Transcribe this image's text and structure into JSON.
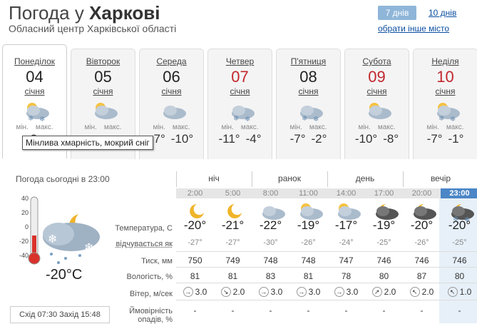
{
  "header": {
    "title_prefix": "Погода",
    "title_mid": "у",
    "title_city": "Харкові",
    "subtitle": "Обласний центр Харківської області",
    "period_7": "7 днів",
    "period_10": "10 днів",
    "other_place": "обрати інше місто"
  },
  "days": [
    {
      "day": "Понеділок",
      "date": "04",
      "month": "січня",
      "icon": "cloud-sun-snow-rain-icon",
      "min_label": "мін.",
      "max_label": "макс.",
      "min": "-2",
      "max": "",
      "red": false
    },
    {
      "day": "Вівторок",
      "date": "05",
      "month": "січня",
      "icon": "sun-cloud-icon",
      "min_label": "мін.",
      "max_label": "макс.",
      "min": "",
      "max": "",
      "red": false
    },
    {
      "day": "Середа",
      "date": "06",
      "month": "січня",
      "icon": "cloudy-icon",
      "min_label": "мін.",
      "max_label": "макс.",
      "min": "-7°",
      "max": "-10°",
      "red": false
    },
    {
      "day": "Четвер",
      "date": "07",
      "month": "січня",
      "icon": "snow-cloud-icon",
      "min_label": "мін.",
      "max_label": "макс.",
      "min": "-11°",
      "max": "-4°",
      "red": true
    },
    {
      "day": "П'ятниця",
      "date": "08",
      "month": "січня",
      "icon": "snow-cloud-icon",
      "min_label": "мін.",
      "max_label": "макс.",
      "min": "-7°",
      "max": "-2°",
      "red": false
    },
    {
      "day": "Субота",
      "date": "09",
      "month": "січня",
      "icon": "sun-cloud-icon",
      "min_label": "мін.",
      "max_label": "макс.",
      "min": "-10°",
      "max": "-8°",
      "red": true
    },
    {
      "day": "Неділя",
      "date": "10",
      "month": "січня",
      "icon": "cloud-sun-snow-icon",
      "min_label": "мін.",
      "max_label": "макс.",
      "min": "-7°",
      "max": "-1°",
      "red": true
    }
  ],
  "tooltip": "Мінлива хмарність, мокрий сніг",
  "now": {
    "label": "Погода сьогодні в 23:00",
    "temp": "-20°C",
    "scale": [
      "40",
      "20",
      "0",
      "-20",
      "-40"
    ],
    "sunrise": "Схід 07:30 Захід 15:48",
    "icon": "moon-cloud-snow-icon"
  },
  "row_labels": {
    "temp": "Температура, С",
    "feel": "відчувається як",
    "press": "Тиск, мм",
    "hum": "Вологість, %",
    "wind": "Вітер, м/сек",
    "prec1": "Ймовірність",
    "prec2": "опадів, %"
  },
  "sections": [
    "ніч",
    "ранок",
    "день",
    "вечір"
  ],
  "hours": [
    {
      "time": "2:00",
      "icon": "moon-icon",
      "temp": "-20°",
      "feel": "-27°",
      "press": "750",
      "hum": "81",
      "wdir": "→",
      "wind": "3.0",
      "prec": "-"
    },
    {
      "time": "5:00",
      "icon": "moon-icon",
      "temp": "-21°",
      "feel": "-27°",
      "press": "749",
      "hum": "81",
      "wdir": "↘",
      "wind": "2.0",
      "prec": "-"
    },
    {
      "time": "8:00",
      "icon": "cloudy-icon",
      "temp": "-22°",
      "feel": "-30°",
      "press": "748",
      "hum": "83",
      "wdir": "→",
      "wind": "3.0",
      "prec": "-"
    },
    {
      "time": "11:00",
      "icon": "sun-cloud-icon",
      "temp": "-19°",
      "feel": "-26°",
      "press": "748",
      "hum": "81",
      "wdir": "→",
      "wind": "3.0",
      "prec": "-"
    },
    {
      "time": "14:00",
      "icon": "sun-cloud-icon",
      "temp": "-17°",
      "feel": "-24°",
      "press": "747",
      "hum": "78",
      "wdir": "→",
      "wind": "3.0",
      "prec": "-"
    },
    {
      "time": "17:00",
      "icon": "moon-cloud-icon",
      "temp": "-19°",
      "feel": "-25°",
      "press": "746",
      "hum": "80",
      "wdir": "↗",
      "wind": "2.0",
      "prec": "-"
    },
    {
      "time": "20:00",
      "icon": "moon-cloud-icon",
      "temp": "-20°",
      "feel": "-26°",
      "press": "746",
      "hum": "87",
      "wdir": "↖",
      "wind": "2.0",
      "prec": "-"
    },
    {
      "time": "23:00",
      "icon": "moon-cloud-snow-icon",
      "temp": "-20°",
      "feel": "-25°",
      "press": "746",
      "hum": "80",
      "wdir": "↖",
      "wind": "1.0",
      "prec": "-"
    }
  ]
}
